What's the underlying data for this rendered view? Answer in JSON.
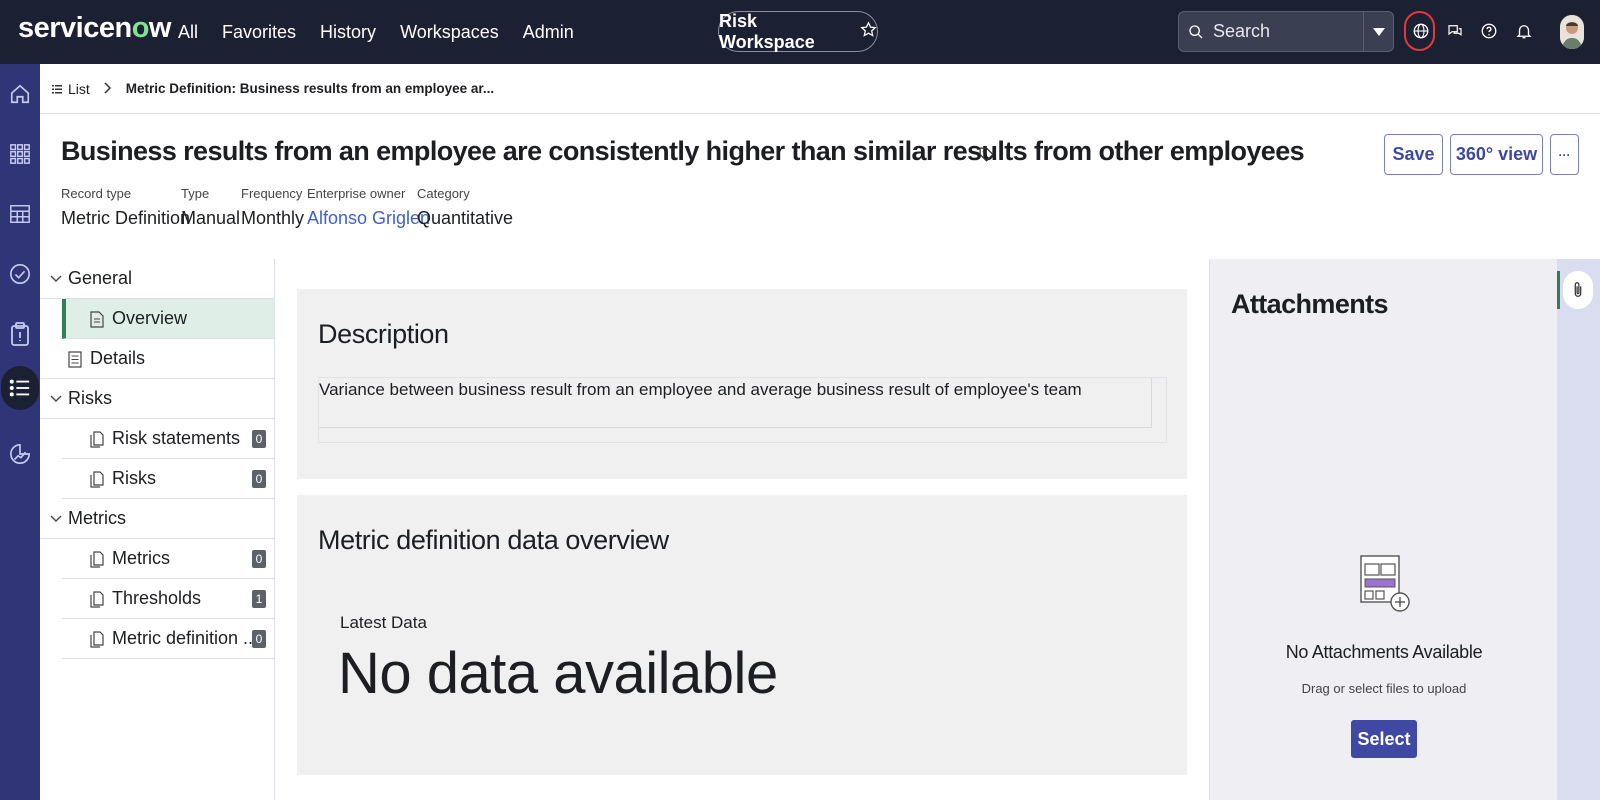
{
  "header": {
    "logo_text_a": "servicen",
    "logo_text_o": "o",
    "logo_text_b": "w",
    "nav": [
      "All",
      "Favorites",
      "History",
      "Workspaces",
      "Admin"
    ],
    "workspace_title": "Risk Workspace",
    "search_placeholder": "Search"
  },
  "breadcrumb": {
    "list_label": "List",
    "current": "Metric Definition: Business results from an employee ar..."
  },
  "record": {
    "title": "Business results from an employee are consistently higher than similar results from other employees",
    "buttons": {
      "save": "Save",
      "view360": "360° view",
      "more": "···"
    },
    "meta": [
      {
        "label": "Record type",
        "value": "Metric Definition"
      },
      {
        "label": "Type",
        "value": "Manual"
      },
      {
        "label": "Frequency",
        "value": "Monthly"
      },
      {
        "label": "Enterprise owner",
        "value": "Alfonso Griglen"
      },
      {
        "label": "Category",
        "value": "Quantitative"
      }
    ]
  },
  "subnav": {
    "general": "General",
    "overview": "Overview",
    "details": "Details",
    "risks_group": "Risks",
    "risk_statements": "Risk statements",
    "risk_statements_count": "0",
    "risks": "Risks",
    "risks_count": "0",
    "metrics_group": "Metrics",
    "metrics": "Metrics",
    "metrics_count": "0",
    "thresholds": "Thresholds",
    "thresholds_count": "1",
    "metric_def": "Metric definition ...",
    "metric_def_count": "0"
  },
  "main": {
    "description_title": "Description",
    "description_text": "Variance between business result from an employee and average business result of employee's team",
    "overview_title": "Metric definition data overview",
    "latest_label": "Latest Data",
    "no_data": "No data available"
  },
  "attachments": {
    "title": "Attachments",
    "empty_title": "No Attachments Available",
    "hint": "Drag or select files to upload",
    "select": "Select"
  },
  "colors": {
    "header_bg": "#1b2033",
    "rail_bg": "#2f3576",
    "accent": "#3f49a3",
    "active_nav": "#dfeee6",
    "active_bar": "#2e7d5b",
    "link": "#3f5fcf"
  }
}
